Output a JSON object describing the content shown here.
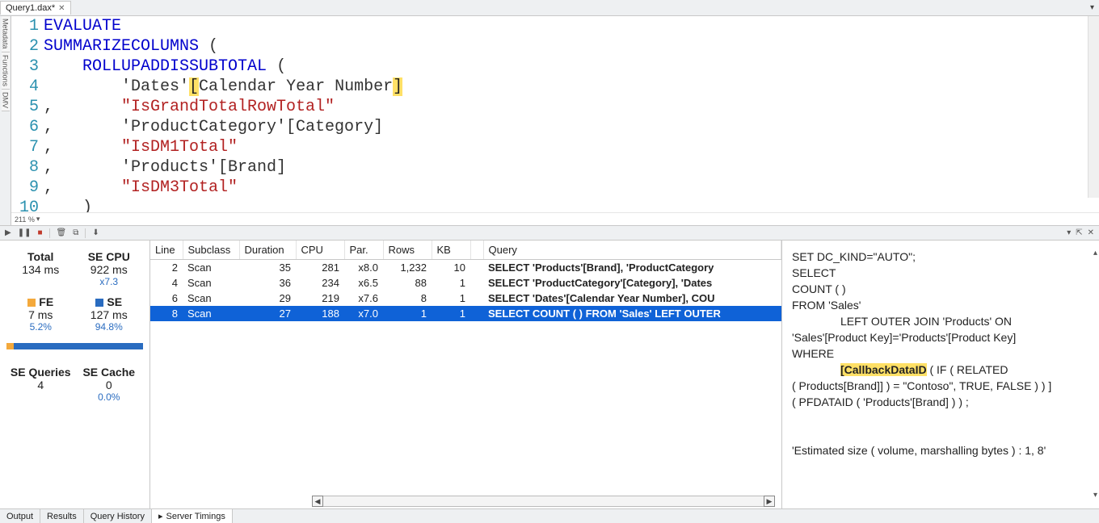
{
  "tab": {
    "title": "Query1.dax*",
    "close": "✕"
  },
  "side_tabs": [
    "Metadata",
    "Functions",
    "DMV"
  ],
  "zoom": {
    "label": "211 %"
  },
  "code_lines": [
    {
      "n": 1,
      "tokens": [
        {
          "t": "EVALUATE",
          "c": "kw"
        }
      ]
    },
    {
      "n": 2,
      "tokens": [
        {
          "t": "SUMMARIZECOLUMNS",
          "c": "kw"
        },
        {
          "t": " (",
          "c": "txt"
        }
      ]
    },
    {
      "n": 3,
      "tokens": [
        {
          "t": "    ",
          "c": "txt"
        },
        {
          "t": "ROLLUPADDISSUBTOTAL",
          "c": "kw"
        },
        {
          "t": " (",
          "c": "txt"
        }
      ]
    },
    {
      "n": 4,
      "tokens": [
        {
          "t": "        'Dates'",
          "c": "txt"
        },
        {
          "t": "[",
          "c": "hl"
        },
        {
          "t": "Calendar Year Number",
          "c": "txt"
        },
        {
          "t": "]",
          "c": "hl"
        }
      ]
    },
    {
      "n": 5,
      "tokens": [
        {
          "t": ",       ",
          "c": "txt"
        },
        {
          "t": "\"IsGrandTotalRowTotal\"",
          "c": "str"
        }
      ]
    },
    {
      "n": 6,
      "tokens": [
        {
          "t": ",       'ProductCategory'[Category]",
          "c": "txt"
        }
      ]
    },
    {
      "n": 7,
      "tokens": [
        {
          "t": ",       ",
          "c": "txt"
        },
        {
          "t": "\"IsDM1Total\"",
          "c": "str"
        }
      ]
    },
    {
      "n": 8,
      "tokens": [
        {
          "t": ",       'Products'[Brand]",
          "c": "txt"
        }
      ]
    },
    {
      "n": 9,
      "tokens": [
        {
          "t": ",       ",
          "c": "txt"
        },
        {
          "t": "\"IsDM3Total\"",
          "c": "str"
        }
      ]
    },
    {
      "n": 10,
      "tokens": [
        {
          "t": "    )",
          "c": "txt"
        }
      ]
    }
  ],
  "stats": {
    "total_head": "Total",
    "total_val": "134 ms",
    "secpu_head": "SE CPU",
    "secpu_val": "922 ms",
    "secpu_sub": "x7.3",
    "fe_head": "FE",
    "fe_val": "7 ms",
    "fe_pct": "5.2%",
    "se_head": "SE",
    "se_val": "127 ms",
    "se_pct": "94.8%",
    "seq_head": "SE Queries",
    "seq_val": "4",
    "cache_head": "SE Cache",
    "cache_val": "0",
    "cache_pct": "0.0%",
    "fe_width": "5.2%",
    "se_width": "94.8%"
  },
  "columns": [
    "Line",
    "Subclass",
    "Duration",
    "CPU",
    "Par.",
    "Rows",
    "KB",
    "",
    "Query"
  ],
  "rows": [
    {
      "line": "2",
      "sub": "Scan",
      "dur": "35",
      "cpu": "281",
      "par": "x8.0",
      "rows": "1,232",
      "kb": "10",
      "q": "SELECT 'Products'[Brand], 'ProductCategory"
    },
    {
      "line": "4",
      "sub": "Scan",
      "dur": "36",
      "cpu": "234",
      "par": "x6.5",
      "rows": "88",
      "kb": "1",
      "q": "SELECT 'ProductCategory'[Category], 'Dates"
    },
    {
      "line": "6",
      "sub": "Scan",
      "dur": "29",
      "cpu": "219",
      "par": "x7.6",
      "rows": "8",
      "kb": "1",
      "q": "SELECT 'Dates'[Calendar Year Number], COU"
    },
    {
      "line": "8",
      "sub": "Scan",
      "dur": "27",
      "cpu": "188",
      "par": "x7.0",
      "rows": "1",
      "kb": "1",
      "q": "SELECT COUNT (  ) FROM 'Sales' LEFT OUTER",
      "selected": true
    }
  ],
  "sql": {
    "l1": "SET DC_KIND=\"AUTO\";",
    "l2": "SELECT",
    "l3": "COUNT (  )",
    "l4": "FROM 'Sales'",
    "l5": "LEFT OUTER JOIN 'Products' ON",
    "l6": "'Sales'[Product Key]='Products'[Product Key]",
    "l7": "WHERE",
    "hl": "[CallbackDataID",
    "l8b": " ( IF ( RELATED",
    "l9": "( Products[Brand]] ) = \"Contoso\", TRUE, FALSE )  ) ]",
    "l10": "( PFDATAID ( 'Products'[Brand] )  ) ;",
    "l11": "'Estimated size ( volume, marshalling bytes ) : 1, 8'"
  },
  "status_tabs": [
    "Output",
    "Results",
    "Query History",
    "Server Timings"
  ],
  "chart_data": {
    "type": "table",
    "title": "Server Timings",
    "columns": [
      "Line",
      "Subclass",
      "Duration",
      "CPU",
      "Par.",
      "Rows",
      "KB",
      "Query"
    ],
    "rows": [
      [
        2,
        "Scan",
        35,
        281,
        "x8.0",
        1232,
        10,
        "SELECT 'Products'[Brand], 'ProductCategory'..."
      ],
      [
        4,
        "Scan",
        36,
        234,
        "x6.5",
        88,
        1,
        "SELECT 'ProductCategory'[Category], 'Dates'..."
      ],
      [
        6,
        "Scan",
        29,
        219,
        "x7.6",
        8,
        1,
        "SELECT 'Dates'[Calendar Year Number], COU..."
      ],
      [
        8,
        "Scan",
        27,
        188,
        "x7.0",
        1,
        1,
        "SELECT COUNT ( ) FROM 'Sales' LEFT OUTER..."
      ]
    ]
  }
}
